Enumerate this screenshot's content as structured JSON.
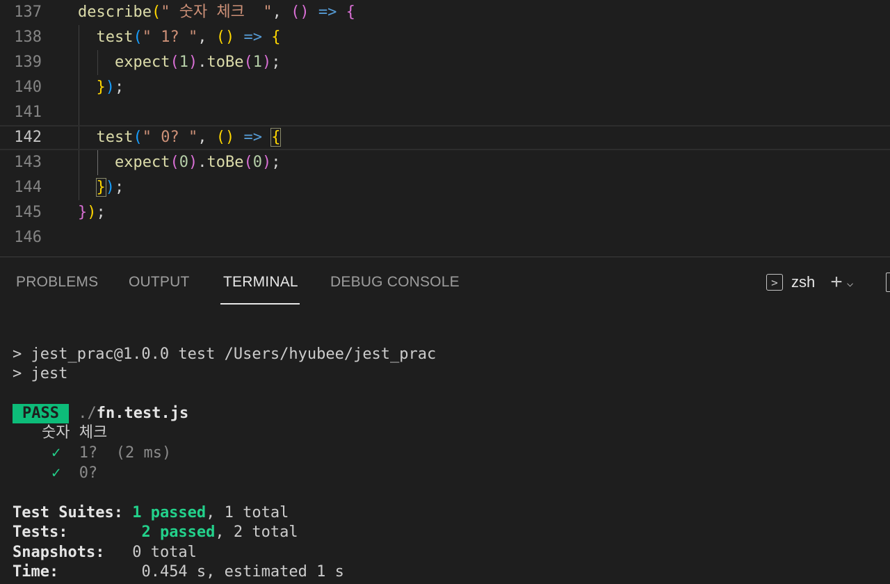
{
  "editor": {
    "lines": [
      {
        "num": "137",
        "tokens": [
          [
            "describe",
            "tok-fn"
          ],
          [
            "(",
            "b1"
          ],
          [
            "\" 숫자 체크  \"",
            "tok-str"
          ],
          [
            ", ",
            "tok-punc"
          ],
          [
            "()",
            "b2"
          ],
          [
            " ",
            "tok-punc"
          ],
          [
            "=>",
            "tok-arrow"
          ],
          [
            " ",
            "tok-punc"
          ],
          [
            "{",
            "b2"
          ]
        ]
      },
      {
        "num": "138",
        "tokens": [
          [
            "  test",
            "tok-fn"
          ],
          [
            "(",
            "b3"
          ],
          [
            "\" 1? \"",
            "tok-str"
          ],
          [
            ", ",
            "tok-punc"
          ],
          [
            "()",
            "b1"
          ],
          [
            " ",
            "tok-punc"
          ],
          [
            "=>",
            "tok-arrow"
          ],
          [
            " ",
            "tok-punc"
          ],
          [
            "{",
            "b1"
          ]
        ]
      },
      {
        "num": "139",
        "tokens": [
          [
            "    expect",
            "tok-fn"
          ],
          [
            "(",
            "b2"
          ],
          [
            "1",
            "tok-num"
          ],
          [
            ")",
            "b2"
          ],
          [
            ".",
            "tok-punc"
          ],
          [
            "toBe",
            "tok-fn"
          ],
          [
            "(",
            "b2"
          ],
          [
            "1",
            "tok-num"
          ],
          [
            ")",
            "b2"
          ],
          [
            ";",
            "tok-punc"
          ]
        ]
      },
      {
        "num": "140",
        "tokens": [
          [
            "  ",
            "tok-punc"
          ],
          [
            "}",
            "b1"
          ],
          [
            ")",
            "b3"
          ],
          [
            ";",
            "tok-punc"
          ]
        ]
      },
      {
        "num": "141",
        "tokens": []
      },
      {
        "num": "142",
        "tokens": [
          [
            "  test",
            "tok-fn"
          ],
          [
            "(",
            "b3"
          ],
          [
            "\" 0? \"",
            "tok-str"
          ],
          [
            ", ",
            "tok-punc"
          ],
          [
            "()",
            "b1"
          ],
          [
            " ",
            "tok-punc"
          ],
          [
            "=>",
            "tok-arrow"
          ],
          [
            " ",
            "tok-punc"
          ],
          [
            "{",
            "b1 match"
          ]
        ]
      },
      {
        "num": "143",
        "tokens": [
          [
            "    expect",
            "tok-fn"
          ],
          [
            "(",
            "b2"
          ],
          [
            "0",
            "tok-num"
          ],
          [
            ")",
            "b2"
          ],
          [
            ".",
            "tok-punc"
          ],
          [
            "toBe",
            "tok-fn"
          ],
          [
            "(",
            "b2"
          ],
          [
            "0",
            "tok-num"
          ],
          [
            ")",
            "b2"
          ],
          [
            ";",
            "tok-punc"
          ]
        ]
      },
      {
        "num": "144",
        "tokens": [
          [
            "  ",
            "tok-punc"
          ],
          [
            "}",
            "b1 match"
          ],
          [
            ")",
            "b3"
          ],
          [
            ";",
            "tok-punc"
          ]
        ]
      },
      {
        "num": "145",
        "tokens": [
          [
            "}",
            "b2"
          ],
          [
            ")",
            "b1"
          ],
          [
            ";",
            "tok-punc"
          ]
        ]
      },
      {
        "num": "146",
        "tokens": []
      }
    ]
  },
  "panel": {
    "tabs": [
      {
        "label": "PROBLEMS",
        "active": false
      },
      {
        "label": "OUTPUT",
        "active": false
      },
      {
        "label": "TERMINAL",
        "active": true
      },
      {
        "label": "DEBUG CONSOLE",
        "active": false
      }
    ],
    "shell_label": "zsh",
    "shell_glyph": ">",
    "plus_glyph": "+",
    "chevron_glyph": "⌵"
  },
  "terminal": {
    "cmd1": "> jest_prac@1.0.0 test /Users/hyubee/jest_prac",
    "cmd2": "> jest",
    "pass_badge": "PASS",
    "file_dir": "./",
    "file_name": "fn.test.js",
    "suite_name": "숫자 체크",
    "tests": [
      {
        "check": "✓",
        "name": "1?",
        "time": "(2 ms)"
      },
      {
        "check": "✓",
        "name": "0?",
        "time": ""
      }
    ],
    "summary": {
      "suites_label": "Test Suites:",
      "suites_passed": "1 passed",
      "suites_total": ", 1 total",
      "tests_label": "Tests:",
      "tests_passed": "2 passed",
      "tests_total": ", 2 total",
      "snapshots_label": "Snapshots:",
      "snapshots_value": "0 total",
      "time_label": "Time:",
      "time_value": "0.454 s, estimated 1 s"
    }
  },
  "colors": {
    "background": "#1e1e1e",
    "pass": "#0dbc79",
    "passed_text": "#23d18b"
  }
}
